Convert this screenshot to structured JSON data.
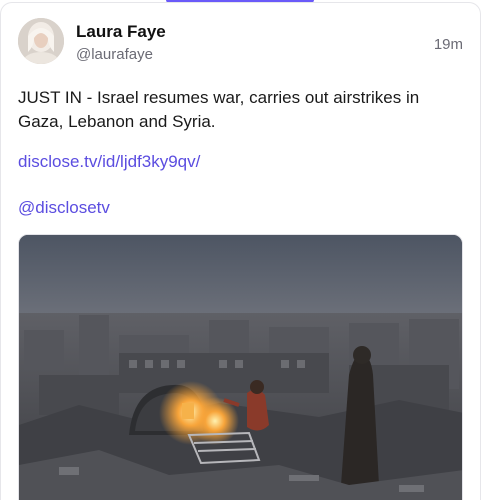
{
  "post": {
    "author_name": "Laura Faye",
    "author_handle": "@laurafaye",
    "timestamp": "19m",
    "text": "JUST IN - Israel resumes war, carries out airstrikes in Gaza, Lebanon and Syria.",
    "links": [
      "disclose.tv/id/ljdf3ky9qv/",
      "@disclosetv"
    ]
  },
  "colors": {
    "accent": "#6a5af9",
    "link": "#5b4de0",
    "secondary_text": "#6b6b75"
  }
}
